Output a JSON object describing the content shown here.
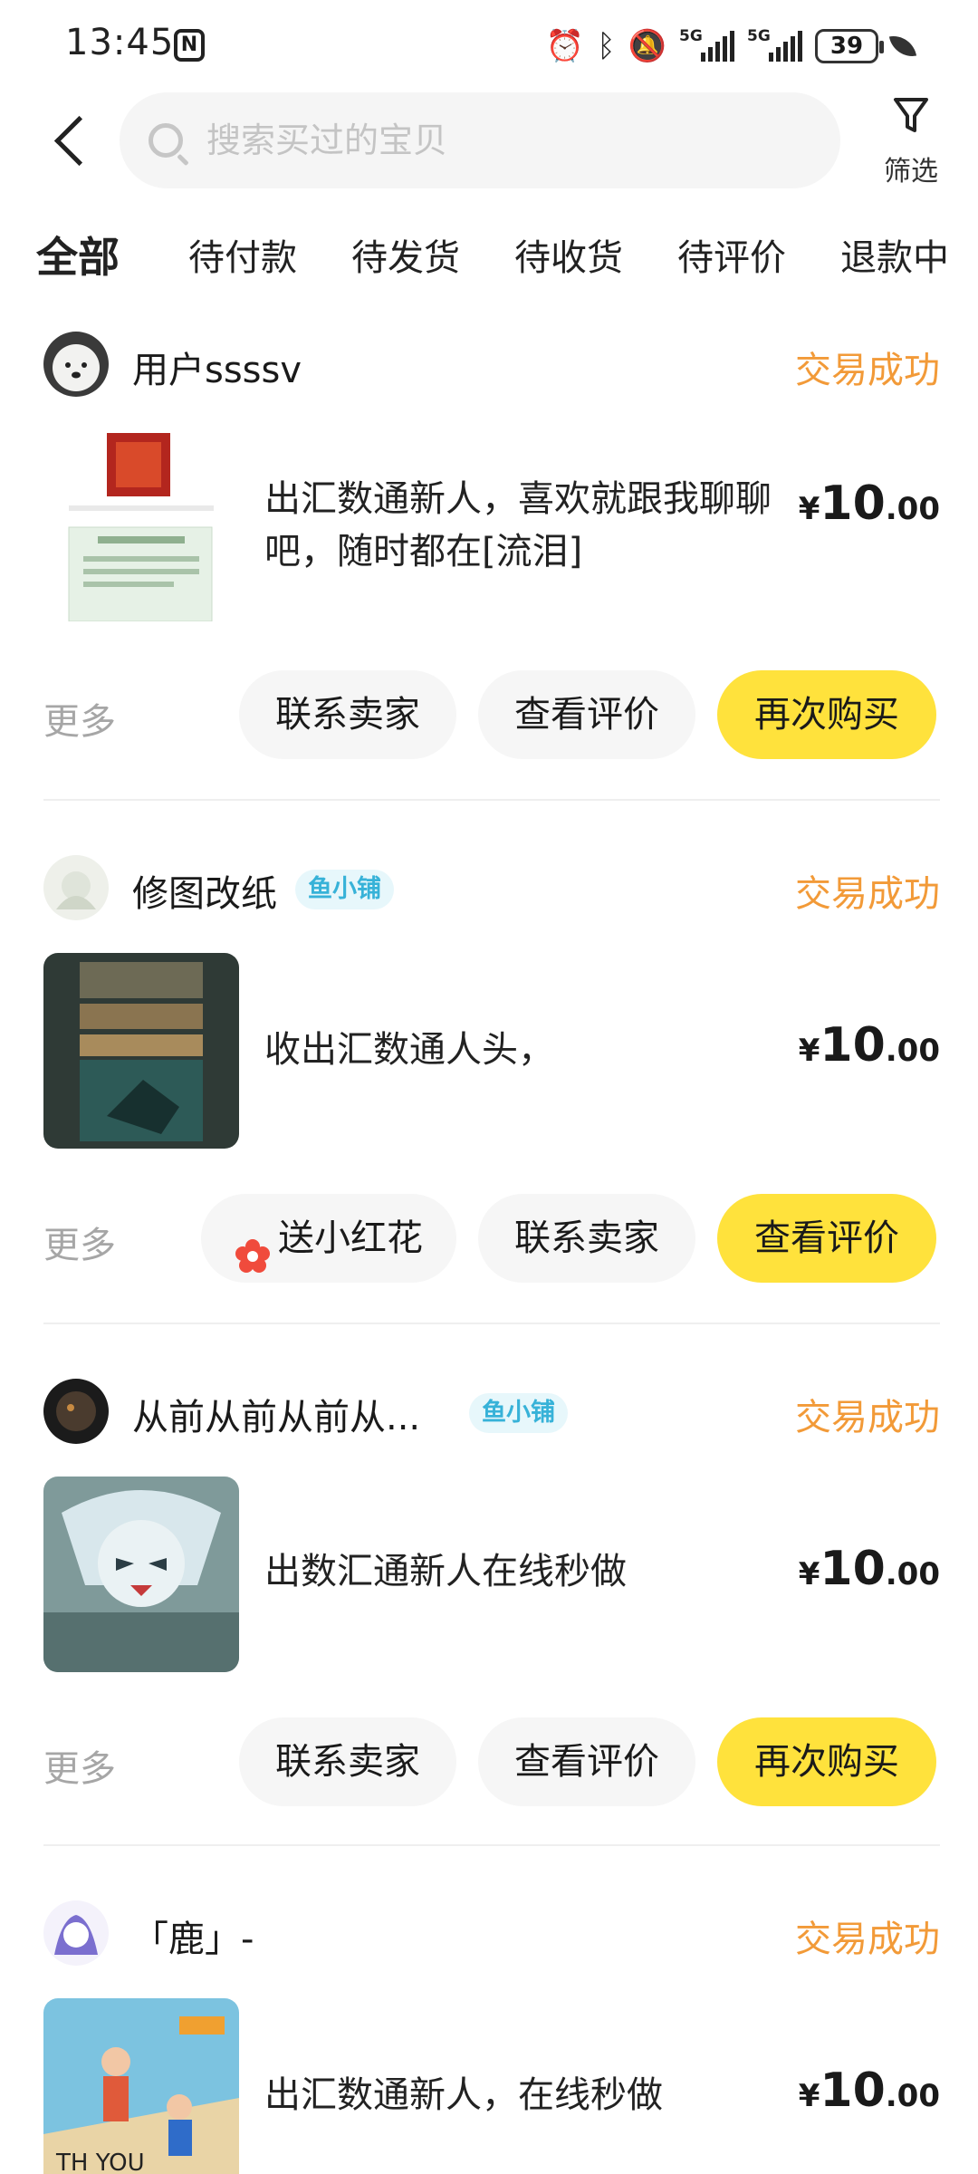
{
  "status_bar": {
    "time": "13:45",
    "nfc": "N",
    "network_1": "5G",
    "network_2": "5G",
    "battery": "39"
  },
  "header": {
    "back_icon": "chevron-left-icon",
    "search_placeholder": "搜索买过的宝贝",
    "filter_label": "筛选"
  },
  "tabs": [
    {
      "label": "全部",
      "active": true
    },
    {
      "label": "待付款",
      "active": false
    },
    {
      "label": "待发货",
      "active": false
    },
    {
      "label": "待收货",
      "active": false
    },
    {
      "label": "待评价",
      "active": false
    },
    {
      "label": "退款中",
      "active": false
    }
  ],
  "orders": [
    {
      "seller": "用户ssssv",
      "badge": "",
      "status": "交易成功",
      "title": "出汇数通新人，喜欢就跟我聊聊吧，随时都在[流泪]",
      "price_currency": "¥",
      "price_int": "10",
      "price_dec": ".00",
      "more": "更多",
      "buttons": [
        "联系卖家",
        "查看评价",
        "再次购买"
      ]
    },
    {
      "seller": "修图改纸",
      "badge": "鱼小铺",
      "status": "交易成功",
      "title": "收出汇数通人头，",
      "price_currency": "¥",
      "price_int": "10",
      "price_dec": ".00",
      "more": "更多",
      "buttons": [
        "送小红花",
        "联系卖家",
        "查看评价"
      ]
    },
    {
      "seller": "从前从前从前从...",
      "badge": "鱼小铺",
      "status": "交易成功",
      "title": "出数汇通新人在线秒做",
      "price_currency": "¥",
      "price_int": "10",
      "price_dec": ".00",
      "more": "更多",
      "buttons": [
        "联系卖家",
        "查看评价",
        "再次购买"
      ]
    },
    {
      "seller": "「鹿」-",
      "badge": "",
      "status": "交易成功",
      "title": "出汇数通新人，在线秒做",
      "price_currency": "¥",
      "price_int": "10",
      "price_dec": ".00"
    }
  ],
  "colors": {
    "accent_yellow": "#ffe23c",
    "status_orange": "#f29a38",
    "badge_blue": "#37b2d8"
  }
}
